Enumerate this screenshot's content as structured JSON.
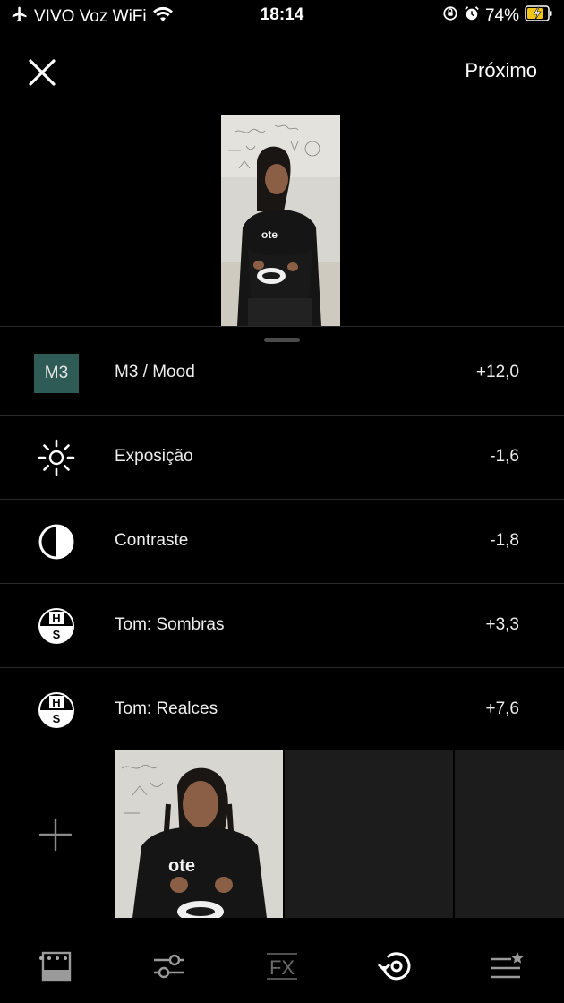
{
  "status_bar": {
    "carrier": "VIVO Voz WiFi",
    "time": "18:14",
    "battery": "74%"
  },
  "top_bar": {
    "next_label": "Próximo"
  },
  "tools": [
    {
      "badge": "M3",
      "label": "M3 / Mood",
      "value": "+12,0",
      "icon": "preset-badge"
    },
    {
      "label": "Exposição",
      "value": "-1,6",
      "icon": "exposure-icon"
    },
    {
      "label": "Contraste",
      "value": "-1,8",
      "icon": "contrast-icon"
    },
    {
      "label": "Tom: Sombras",
      "value": "+3,3",
      "icon": "tone-hs-icon",
      "icon_top": "H",
      "icon_bottom": "S"
    },
    {
      "label": "Tom: Realces",
      "value": "+7,6",
      "icon": "tone-hs-icon",
      "icon_top": "H",
      "icon_bottom": "S"
    }
  ],
  "bottom_tabs": {
    "fx_label": "FX"
  },
  "colors": {
    "background": "#000000",
    "preset_badge": "#2f5b57",
    "divider": "#2a2a2a"
  }
}
